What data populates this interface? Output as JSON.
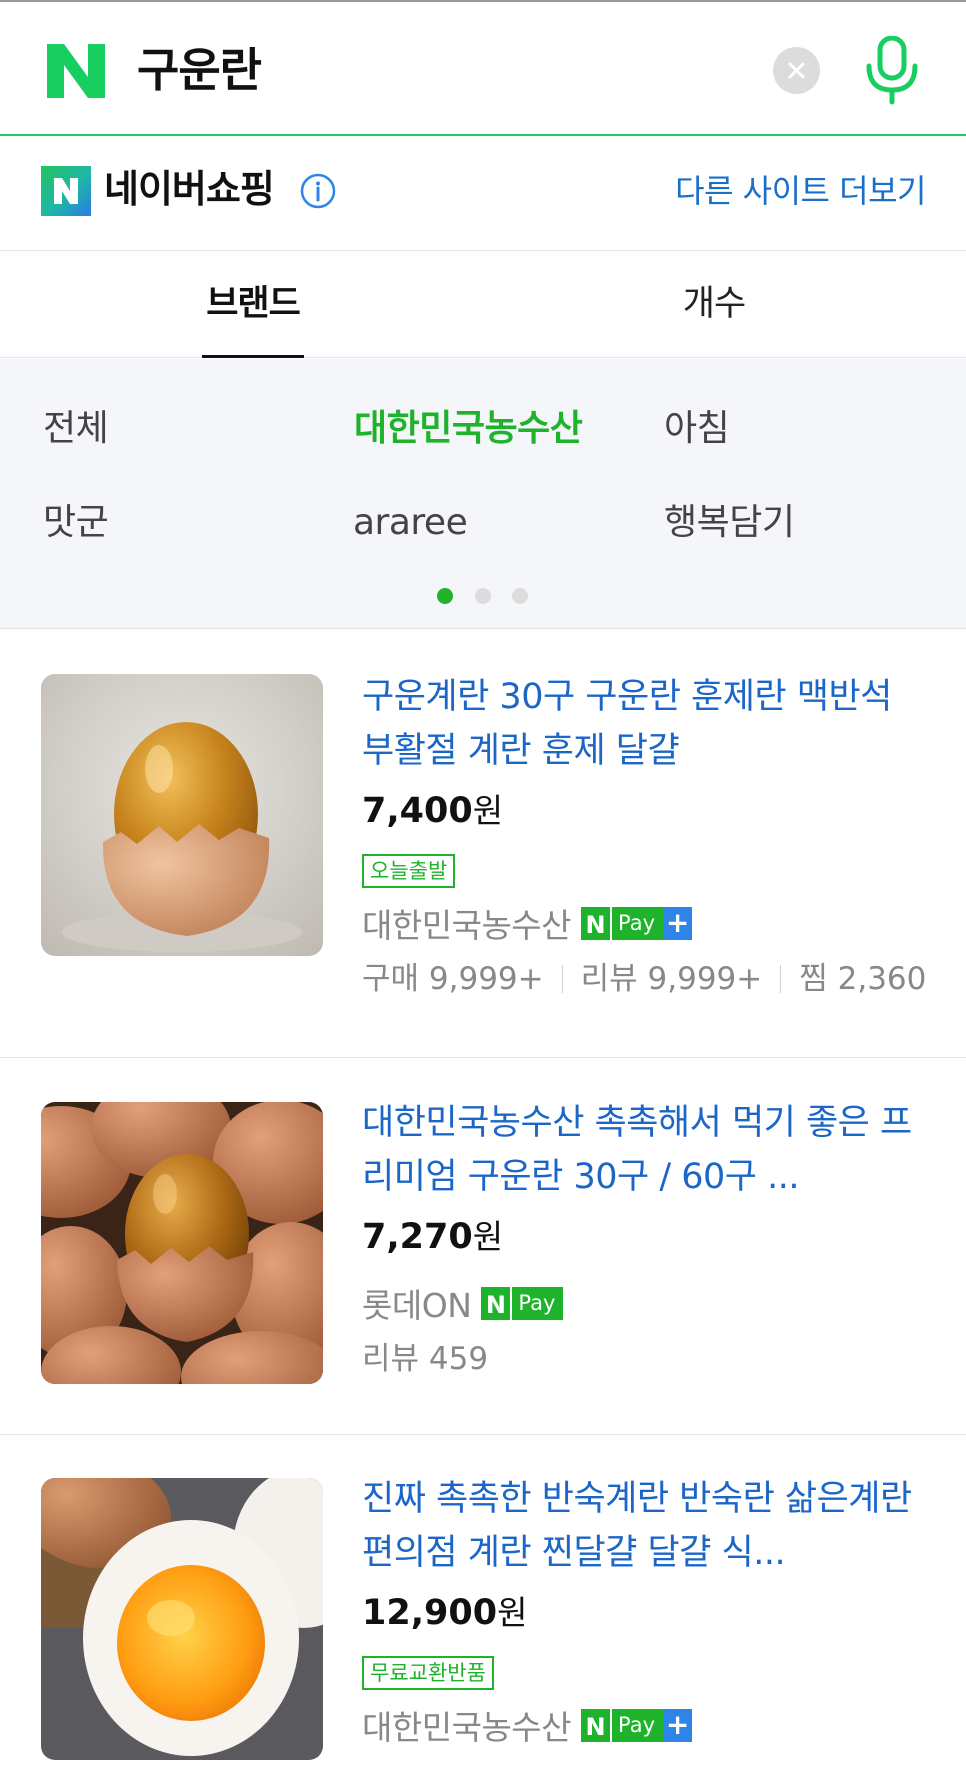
{
  "search": {
    "query": "구운란"
  },
  "shop_header": {
    "title": "네이버쇼핑",
    "more_sites": "다른 사이트 더보기"
  },
  "tabs": [
    {
      "label": "브랜드",
      "selected": true
    },
    {
      "label": "개수",
      "selected": false
    }
  ],
  "brand_filters": [
    {
      "label": "전체",
      "selected": false
    },
    {
      "label": "대한민국농수산",
      "selected": true
    },
    {
      "label": "아침",
      "selected": false
    },
    {
      "label": "맛군",
      "selected": false
    },
    {
      "label": "araree",
      "selected": false
    },
    {
      "label": "행복담기",
      "selected": false
    }
  ],
  "pagination": {
    "pages": 3,
    "current": 1
  },
  "products": [
    {
      "title": "구운계란 30구 구운란 훈제란 맥반석 부활절 계란 훈제 달걀",
      "price": "7,400",
      "currency": "원",
      "tag": "오늘출발",
      "seller": "대한민국농수산",
      "stats": [
        "구매 9,999+",
        "리뷰 9,999+",
        "찜 2,360"
      ]
    },
    {
      "title": "대한민국농수산 촉촉해서 먹기 좋은 프리미엄 구운란 30구 / 60구 ...",
      "price": "7,270",
      "currency": "원",
      "seller": "롯데ON",
      "stats": [
        "리뷰 459"
      ]
    },
    {
      "title": "진짜 촉촉한 반숙계란 반숙란 삶은계란 편의점 계란 찐달걀 달걀 식...",
      "price": "12,900",
      "currency": "원",
      "tag": "무료교환반품",
      "seller": "대한민국농수산"
    }
  ],
  "colors": {
    "naver_green": "#19ce60",
    "active_green": "#1fb32c",
    "link_blue": "#1b66c7",
    "npay_plus_blue": "#2f84e8"
  },
  "icons": [
    "naver-n-icon",
    "clear-icon",
    "mic-icon",
    "naver-shopping-logo-icon",
    "info-icon",
    "npay-icon"
  ]
}
